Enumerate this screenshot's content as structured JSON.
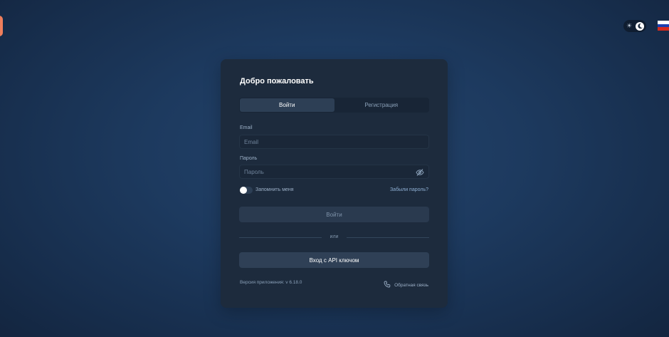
{
  "brand": {
    "accent": "#ee7e5c"
  },
  "header": {
    "theme_toggle": {
      "icons": [
        "sun-icon",
        "moon-icon"
      ],
      "mode": "dark"
    },
    "language": {
      "flag": "ru-flag",
      "colors": [
        "#ffffff",
        "#1c3fb0",
        "#d52b1e"
      ]
    }
  },
  "login": {
    "title": "Добро пожаловать",
    "tabs": [
      {
        "label": "Войти",
        "active": true
      },
      {
        "label": "Регистрация",
        "active": false
      }
    ],
    "email": {
      "label": "Email",
      "placeholder": "Email",
      "value": ""
    },
    "password": {
      "label": "Пароль",
      "placeholder": "Пароль",
      "value": "",
      "icon": "eye-off-icon"
    },
    "remember_label": "Запомнить меня",
    "remember_checked": false,
    "forgot_label": "Забыли пароль?",
    "submit_label": "Войти",
    "divider_text": "или",
    "api_key_label": "Вход с API ключом",
    "version_text": "Версия приложения: v 6.18.0",
    "feedback_label": "Обратная связь"
  }
}
